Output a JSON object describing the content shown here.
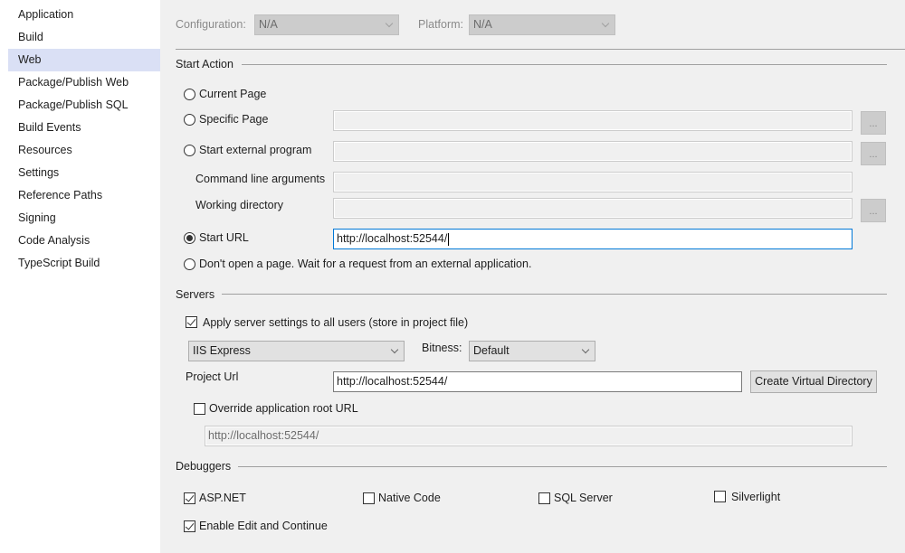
{
  "sidebar": {
    "items": [
      {
        "label": "Application",
        "active": false
      },
      {
        "label": "Build",
        "active": false
      },
      {
        "label": "Web",
        "active": true
      },
      {
        "label": "Package/Publish Web",
        "active": false
      },
      {
        "label": "Package/Publish SQL",
        "active": false
      },
      {
        "label": "Build Events",
        "active": false
      },
      {
        "label": "Resources",
        "active": false
      },
      {
        "label": "Settings",
        "active": false
      },
      {
        "label": "Reference Paths",
        "active": false
      },
      {
        "label": "Signing",
        "active": false
      },
      {
        "label": "Code Analysis",
        "active": false
      },
      {
        "label": "TypeScript Build",
        "active": false
      }
    ]
  },
  "header": {
    "configuration_label": "Configuration:",
    "configuration_value": "N/A",
    "platform_label": "Platform:",
    "platform_value": "N/A"
  },
  "start_action": {
    "title": "Start Action",
    "current_page": "Current Page",
    "specific_page": "Specific Page",
    "specific_page_value": "",
    "start_external_program": "Start external program",
    "external_program_value": "",
    "command_line_arguments": "Command line arguments",
    "command_line_value": "",
    "working_directory": "Working directory",
    "working_directory_value": "",
    "start_url": "Start URL",
    "start_url_value": "http://localhost:52544/",
    "dont_open": "Don't open a page.  Wait for a request from an external application.",
    "selected": "start_url",
    "browse_label": "..."
  },
  "servers": {
    "title": "Servers",
    "apply_settings_label": "Apply server settings to all users (store in project file)",
    "apply_settings_checked": true,
    "server_value": "IIS Express",
    "bitness_label": "Bitness:",
    "bitness_value": "Default",
    "project_url_label": "Project Url",
    "project_url_value": "http://localhost:52544/",
    "create_virtual_directory": "Create Virtual Directory",
    "override_root_label": "Override application root URL",
    "override_root_checked": false,
    "override_root_value": "http://localhost:52544/"
  },
  "debuggers": {
    "title": "Debuggers",
    "aspnet": {
      "label": "ASP.NET",
      "checked": true
    },
    "native_code": {
      "label": "Native Code",
      "checked": false
    },
    "sql_server": {
      "label": "SQL Server",
      "checked": false
    },
    "silverlight": {
      "label": "Silverlight",
      "checked": false
    },
    "edit_continue": {
      "label": "Enable Edit and Continue",
      "checked": true
    }
  }
}
